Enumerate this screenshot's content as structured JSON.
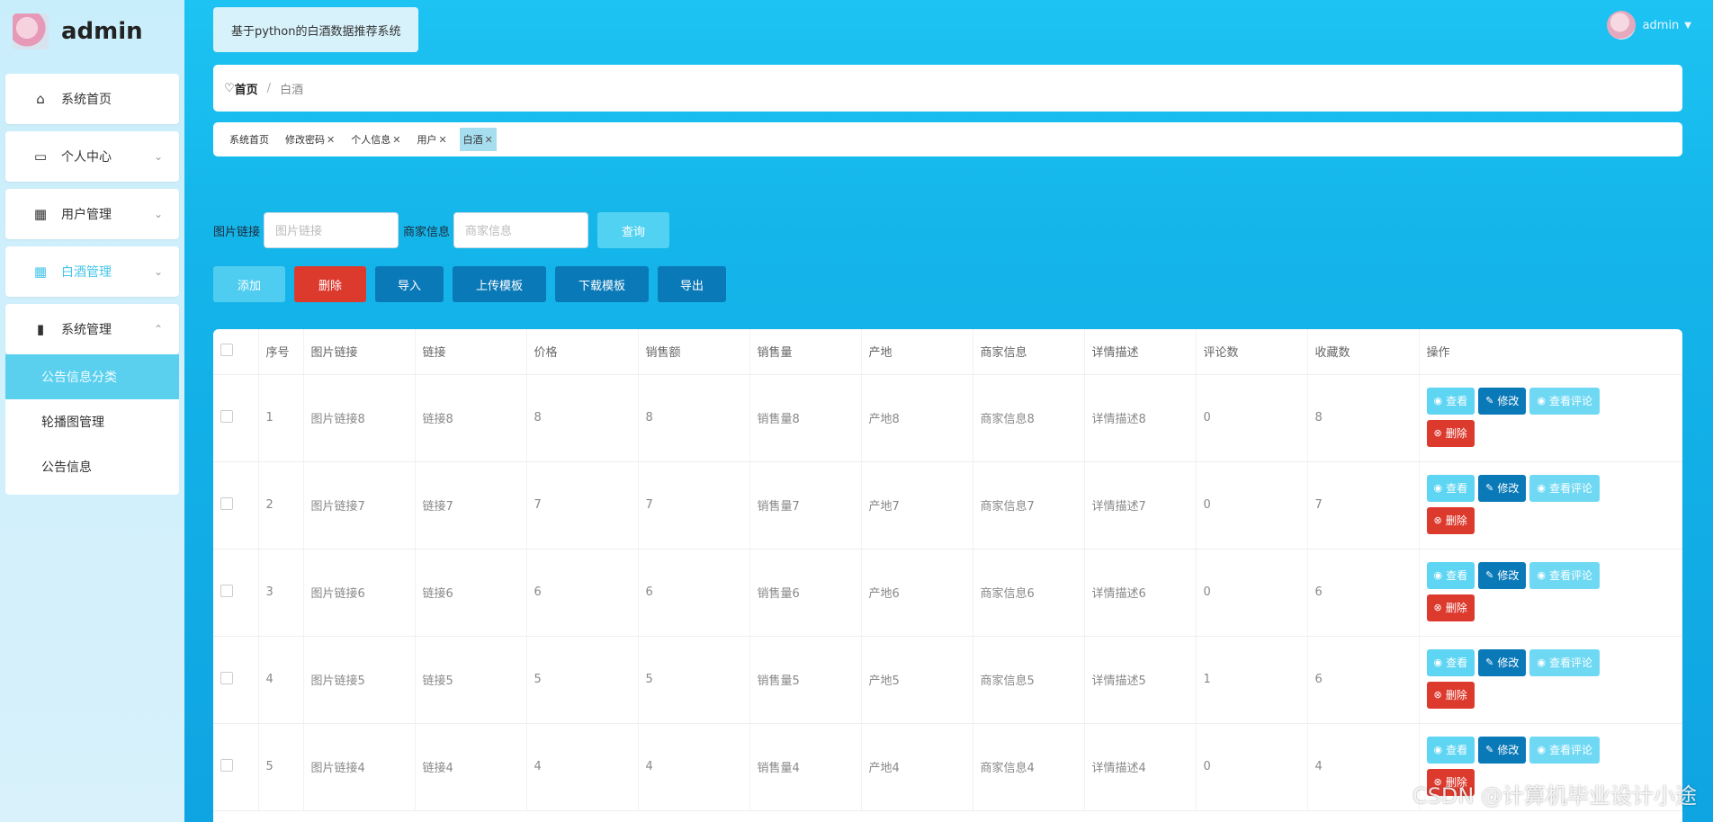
{
  "app": {
    "user": "admin"
  },
  "sidebar": {
    "items": [
      {
        "label": "系统首页",
        "icon": "home-icon"
      },
      {
        "label": "个人中心",
        "icon": "card-icon"
      },
      {
        "label": "用户管理",
        "icon": "grid-icon"
      },
      {
        "label": "白酒管理",
        "icon": "grid-icon"
      },
      {
        "label": "系统管理",
        "icon": "bar-chart-icon"
      }
    ],
    "submenu": [
      "公告信息分类",
      "轮播图管理",
      "公告信息"
    ]
  },
  "header": {
    "system_title": "基于python的白酒数据推荐系统",
    "user": "admin"
  },
  "breadcrumb": {
    "home": "首页",
    "separator": "/",
    "current": "白酒"
  },
  "tags": [
    {
      "label": "系统首页",
      "closable": false
    },
    {
      "label": "修改密码",
      "closable": true
    },
    {
      "label": "个人信息",
      "closable": true
    },
    {
      "label": "用户",
      "closable": true
    },
    {
      "label": "白酒",
      "closable": true
    }
  ],
  "search": {
    "field1_label": "图片链接",
    "field1_placeholder": "图片链接",
    "field2_label": "商家信息",
    "field2_placeholder": "商家信息",
    "query_button": "查询"
  },
  "toolbar": {
    "add": "添加",
    "delete": "删除",
    "import": "导入",
    "upload_template": "上传模板",
    "download_template": "下载模板",
    "export": "导出"
  },
  "table": {
    "columns": [
      "序号",
      "图片链接",
      "链接",
      "价格",
      "销售额",
      "销售量",
      "产地",
      "商家信息",
      "详情描述",
      "评论数",
      "收藏数",
      "操作"
    ],
    "rows": [
      [
        "1",
        "图片链接8",
        "链接8",
        "8",
        "8",
        "销售量8",
        "产地8",
        "商家信息8",
        "详情描述8",
        "0",
        "8"
      ],
      [
        "2",
        "图片链接7",
        "链接7",
        "7",
        "7",
        "销售量7",
        "产地7",
        "商家信息7",
        "详情描述7",
        "0",
        "7"
      ],
      [
        "3",
        "图片链接6",
        "链接6",
        "6",
        "6",
        "销售量6",
        "产地6",
        "商家信息6",
        "详情描述6",
        "0",
        "6"
      ],
      [
        "4",
        "图片链接5",
        "链接5",
        "5",
        "5",
        "销售量5",
        "产地5",
        "商家信息5",
        "详情描述5",
        "1",
        "6"
      ],
      [
        "5",
        "图片链接4",
        "链接4",
        "4",
        "4",
        "销售量4",
        "产地4",
        "商家信息4",
        "详情描述4",
        "0",
        "4"
      ]
    ],
    "ops": {
      "view": "查看",
      "edit": "修改",
      "comments": "查看评论",
      "delete": "删除"
    }
  },
  "watermark": "CSDN @计算机毕业设计小途"
}
